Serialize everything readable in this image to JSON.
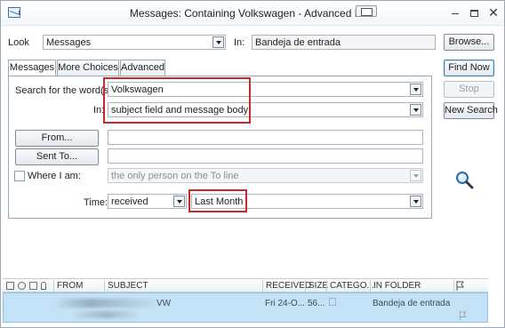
{
  "window": {
    "title": "Messages: Containing Volkswagen - Advanced Find"
  },
  "look": {
    "label": "Look",
    "value": "Messages",
    "in_label": "In:",
    "in_value": "Bandeja de entrada",
    "browse_label": "Browse..."
  },
  "tabs": [
    {
      "label": "Messages"
    },
    {
      "label": "More Choices"
    },
    {
      "label": "Advanced"
    }
  ],
  "actions": {
    "find_now": "Find Now",
    "stop": "Stop",
    "new_search": "New Search"
  },
  "form": {
    "search_label": "Search for the word(s):",
    "search_value": "Volkswagen",
    "in_label": "In:",
    "in_value": "subject field and message body",
    "from_button": "From...",
    "from_value": "",
    "sent_to_button": "Sent To...",
    "sent_to_value": "",
    "where_label": "Where I am:",
    "where_value": "the only person on the To line",
    "time_label": "Time:",
    "time_type": "received",
    "time_range": "Last Month"
  },
  "results": {
    "columns": [
      "FROM",
      "SUBJECT",
      "RECEIVED",
      "SIZE",
      "CATEGO...",
      "IN FOLDER"
    ],
    "rows": [
      {
        "subject": "VW",
        "received": "Fri 24-O...",
        "size": "56...",
        "folder": "Bandeja de entrada"
      }
    ]
  },
  "colors": {
    "highlight": "#c42a2a",
    "selected_row": "#c4e2f6",
    "default_button_border": "#3c7fb1"
  }
}
